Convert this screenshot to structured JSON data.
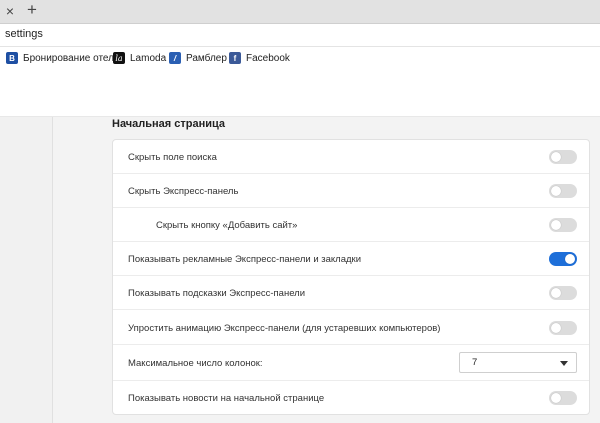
{
  "tabs": {
    "close_glyph": "×",
    "new_tab_glyph": "+"
  },
  "address": {
    "value": "settings"
  },
  "bookmarks": [
    {
      "icon": "booking-favicon",
      "glyph": "B",
      "label": "Бронирование отел"
    },
    {
      "icon": "lamoda-favicon",
      "glyph": "la",
      "label": "Lamoda"
    },
    {
      "icon": "rambler-favicon",
      "glyph": "/",
      "label": "Рамблер"
    },
    {
      "icon": "facebook-favicon",
      "glyph": "f",
      "label": "Facebook"
    }
  ],
  "section": {
    "title": "Начальная страница"
  },
  "settings": {
    "hide_search": {
      "label": "Скрыть поле поиска",
      "enabled": false
    },
    "hide_speed_dial": {
      "label": "Скрыть Экспресс-панель",
      "enabled": false
    },
    "hide_add_site": {
      "label": "Скрыть кнопку «Добавить сайт»",
      "enabled": false
    },
    "show_promo": {
      "label": "Показывать рекламные Экспресс-панели и закладки",
      "enabled": true
    },
    "show_hints": {
      "label": "Показывать подсказки Экспресс-панели",
      "enabled": false
    },
    "simplify_animation": {
      "label": "Упростить анимацию Экспресс-панели (для устаревших компьютеров)",
      "enabled": false
    },
    "max_columns": {
      "label": "Максимальное число колонок:",
      "value": "7"
    },
    "show_news": {
      "label": "Показывать новости на начальной странице",
      "enabled": false
    }
  },
  "colors": {
    "accent": "#1e6fd9",
    "toggle_off": "#dcdcdc"
  }
}
